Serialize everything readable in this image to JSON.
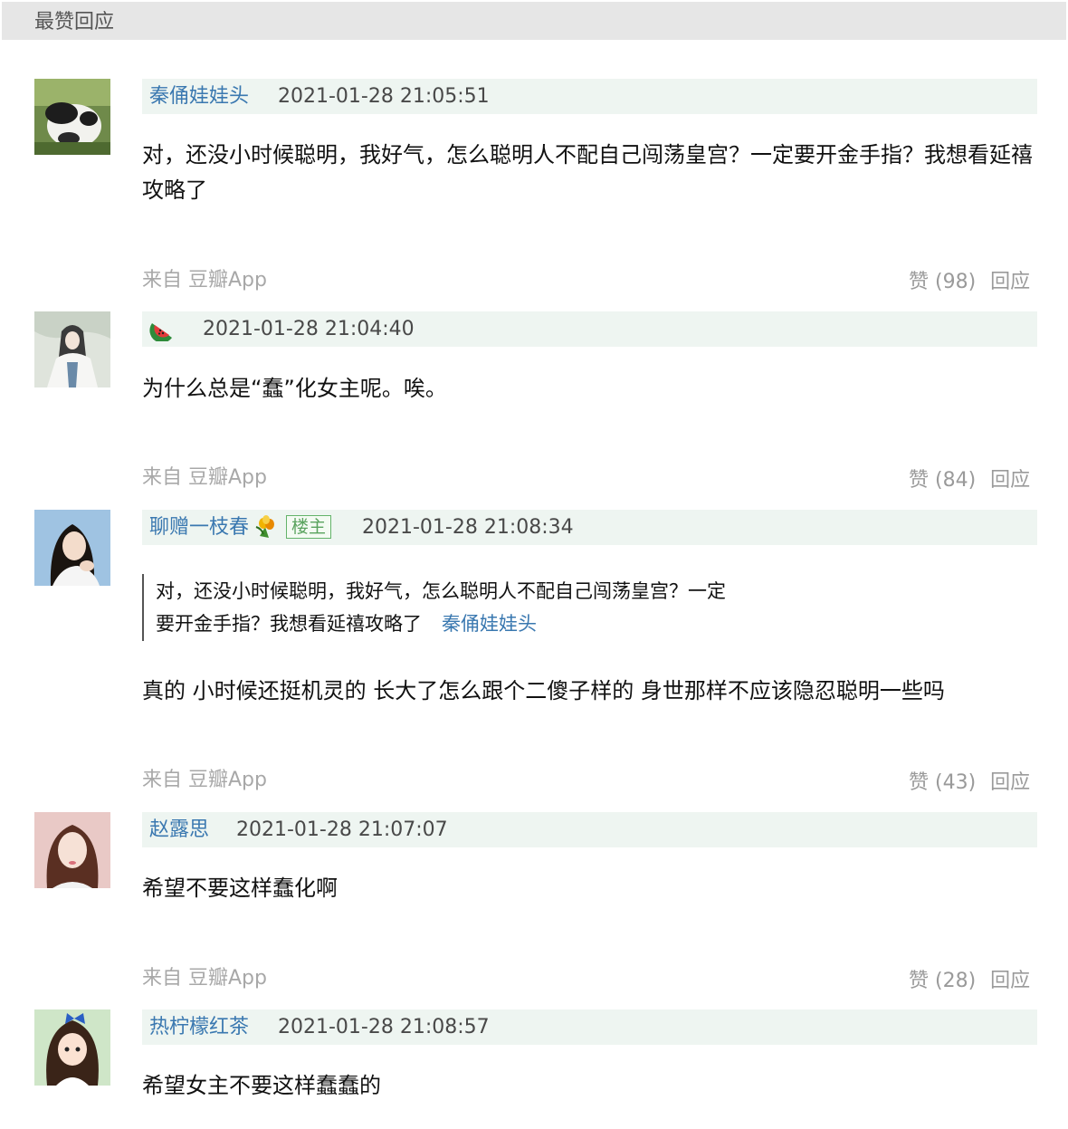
{
  "header": {
    "title": "最赞回应"
  },
  "comments": [
    {
      "author": "秦俑娃娃头",
      "time": "2021-01-28 21:05:51",
      "text": "对，还没小时候聪明，我好气，怎么聪明人不配自己闯荡皇宫？一定要开金手指？我想看延禧攻略了",
      "source": "来自 豆瓣App",
      "like_label": "赞 (98)",
      "reply_label": "回应",
      "avatar_icon": "panda-avatar-icon"
    },
    {
      "author": "",
      "author_icon": "watermelon-icon",
      "time": "2021-01-28 21:04:40",
      "text": "为什么总是“蠢”化女主呢。唉。",
      "source": "来自 豆瓣App",
      "like_label": "赞 (84)",
      "reply_label": "回应",
      "avatar_icon": "ancient-lady-avatar-icon"
    },
    {
      "author": "聊赠一枝春",
      "author_icon": "flower-bouquet-icon",
      "badge": "楼主",
      "time": "2021-01-28 21:08:34",
      "quote": {
        "text_line1": "对，还没小时候聪明，我好气，怎么聪明人不配自己闯荡皇宫？一定",
        "text_line2": "要开金手指？我想看延禧攻略了",
        "author": "秦俑娃娃头"
      },
      "text": "真的 小时候还挺机灵的 长大了怎么跟个二傻子样的 身世那样不应该隐忍聪明一些吗",
      "source": "来自 豆瓣App",
      "like_label": "赞 (43)",
      "reply_label": "回应",
      "avatar_icon": "girl-portrait-avatar-icon"
    },
    {
      "author": "赵露思",
      "time": "2021-01-28 21:07:07",
      "text": "希望不要这样蠢化啊",
      "source": "来自 豆瓣App",
      "like_label": "赞 (28)",
      "reply_label": "回应",
      "avatar_icon": "actress-portrait-avatar-icon"
    },
    {
      "author": "热柠檬红茶",
      "time": "2021-01-28 21:08:57",
      "text": "希望女主不要这样蠢蠢的",
      "avatar_icon": "cartoon-girl-avatar-icon"
    }
  ],
  "colors": {
    "header_bg": "#e6e6e6",
    "meta_bar_bg": "#eef5f1",
    "link": "#3a78b0",
    "muted": "#a8a8a8",
    "badge_green": "#5aa35e"
  }
}
